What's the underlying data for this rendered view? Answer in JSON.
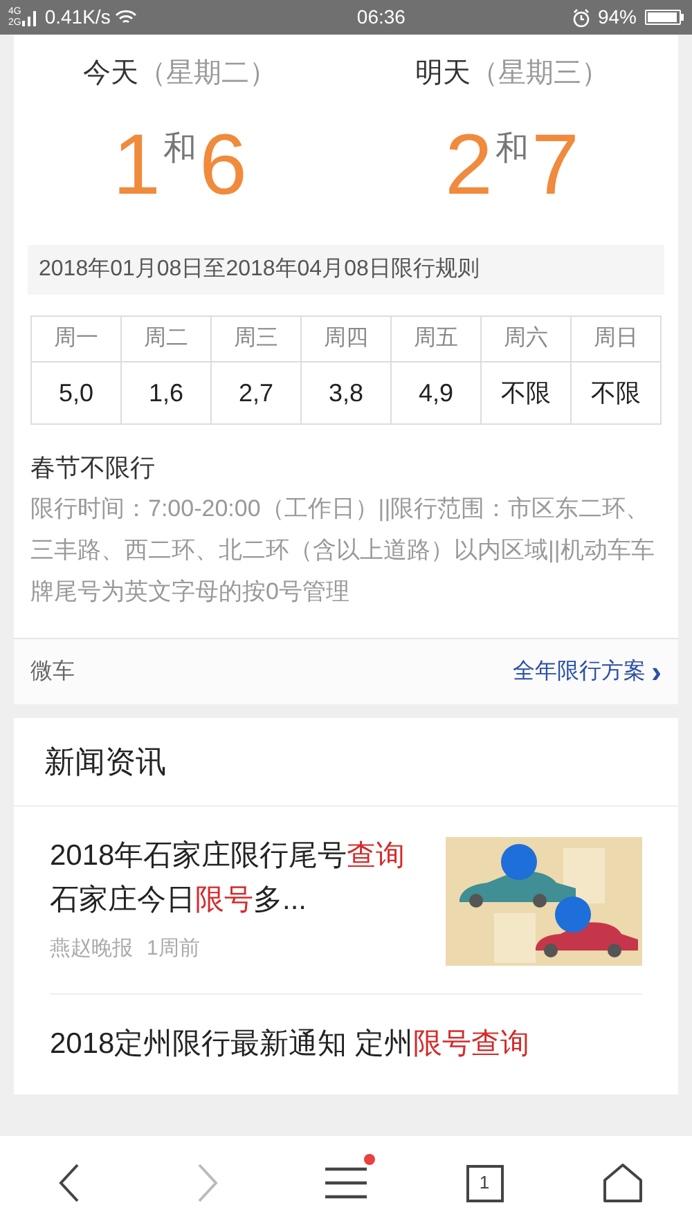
{
  "status_bar": {
    "network": [
      "4G",
      "2G"
    ],
    "speed": "0.41K/s",
    "time": "06:36",
    "battery": "94%"
  },
  "days": [
    {
      "label": "今天",
      "weekday": "（星期二）",
      "first": "1",
      "joiner": "和",
      "second": "6"
    },
    {
      "label": "明天",
      "weekday": "（星期三）",
      "first": "2",
      "joiner": "和",
      "second": "7"
    }
  ],
  "rule_title": "2018年01月08日至2018年04月08日限行规则",
  "table": {
    "columns": [
      "周一",
      "周二",
      "周三",
      "周四",
      "周五",
      "周六",
      "周日"
    ],
    "row": [
      "5,0",
      "1,6",
      "2,7",
      "3,8",
      "4,9",
      "不限",
      "不限"
    ]
  },
  "notice": "春节不限行",
  "details": "限行时间：7:00-20:00（工作日）||限行范围：市区东二环、三丰路、西二环、北二环（含以上道路）以内区域||机动车车牌尾号为英文字母的按0号管理",
  "footer": {
    "source": "微车",
    "link": "全年限行方案",
    "chevron": "›"
  },
  "news": {
    "title": "新闻资讯",
    "items": [
      {
        "kind": "picture",
        "title": [
          {
            "text": "2018年石家庄限行尾号",
            "highlight": false
          },
          {
            "text": "查询",
            "highlight": true
          },
          {
            "text": " 石家庄今日",
            "highlight": false
          },
          {
            "text": "限号",
            "highlight": true
          },
          {
            "text": "多...",
            "highlight": false
          }
        ],
        "source": "燕赵晚报",
        "time": "1周前"
      },
      {
        "kind": "text",
        "title": [
          {
            "text": "2018定州限行最新通知 定州",
            "highlight": false
          },
          {
            "text": "限号查询",
            "highlight": true
          }
        ]
      }
    ]
  },
  "bottom_nav": {
    "back_disabled": false,
    "forward_disabled": true,
    "menu_badge": true,
    "tab_count": "1"
  }
}
